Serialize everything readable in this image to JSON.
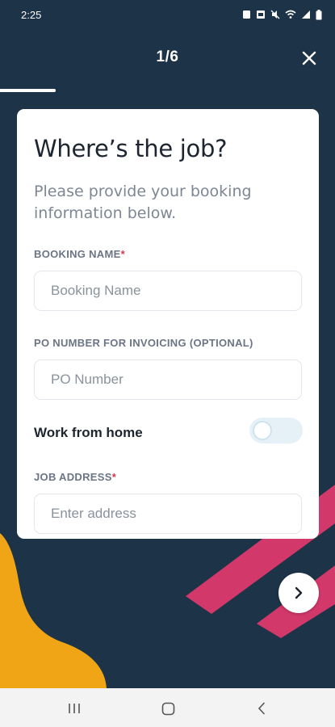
{
  "status_bar": {
    "time": "2:25",
    "icons": [
      "sim-icon",
      "photo-notification-icon",
      "mute-icon",
      "wifi-icon",
      "signal-icon",
      "battery-icon"
    ]
  },
  "header": {
    "step": "1/6",
    "close_icon": "close-icon",
    "progress": 0.1667
  },
  "form": {
    "title": "Where’s the job?",
    "subtitle": "Please provide your booking information below.",
    "booking_name": {
      "label": "BOOKING NAME",
      "required_mark": "*",
      "value": "",
      "placeholder": "Booking Name"
    },
    "po_number": {
      "label": "PO NUMBER FOR INVOICING (OPTIONAL)",
      "value": "",
      "placeholder": "PO Number"
    },
    "work_from_home": {
      "label": "Work from home",
      "on": false
    },
    "job_address": {
      "label": "JOB ADDRESS",
      "required_mark": "*",
      "value": "",
      "placeholder": "Enter address"
    }
  },
  "next_button": {
    "icon": "chevron-right-icon"
  },
  "nav_bar": {
    "buttons": [
      "recent-apps-icon",
      "home-icon",
      "back-icon"
    ]
  },
  "colors": {
    "background": "#1d3348",
    "accent_yellow": "#f0a516",
    "accent_pink": "#d2386a",
    "required_red": "#d23a4f",
    "card": "#ffffff"
  }
}
